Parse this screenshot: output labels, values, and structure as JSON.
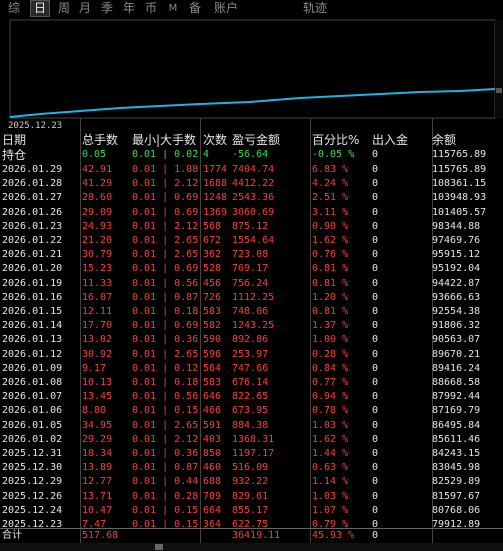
{
  "tabs": [
    "综",
    "日",
    "周",
    "月",
    "季",
    "年",
    "币",
    "M",
    "备",
    "账户",
    "轨迹"
  ],
  "active_tab": "日",
  "chart": {
    "start_date_label": "2025.12.23",
    "line_color": "#1fb2e6"
  },
  "headers": {
    "date": "日期",
    "lots": "总手数",
    "minmax": "最小|大手数",
    "count": "次数",
    "pnl": "盈亏金额",
    "pct": "百分比%",
    "flow": "出入金",
    "balance": "余额"
  },
  "position_row": {
    "date": "持仓",
    "lots": "0.05",
    "minmax": "0.01 | 0.02",
    "count": "4",
    "pnl": "-56.64",
    "pct": "-0.05 %",
    "flow": "0",
    "balance": "115765.89"
  },
  "rows": [
    {
      "date": "2026.01.29",
      "lots": "42.91",
      "minmax": "0.01 | 1.08",
      "count": "1774",
      "pnl": "7404.74",
      "pct": "6.83 %",
      "flow": "0",
      "balance": "115765.89"
    },
    {
      "date": "2026.01.28",
      "lots": "41.29",
      "minmax": "0.01 | 2.12",
      "count": "1688",
      "pnl": "4412.22",
      "pct": "4.24 %",
      "flow": "0",
      "balance": "108361.15"
    },
    {
      "date": "2026.01.27",
      "lots": "28.60",
      "minmax": "0.01 | 0.69",
      "count": "1248",
      "pnl": "2543.36",
      "pct": "2.51 %",
      "flow": "0",
      "balance": "103948.93"
    },
    {
      "date": "2026.01.26",
      "lots": "29.09",
      "minmax": "0.01 | 0.69",
      "count": "1369",
      "pnl": "3060.69",
      "pct": "3.11 %",
      "flow": "0",
      "balance": "101405.57"
    },
    {
      "date": "2026.01.23",
      "lots": "24.93",
      "minmax": "0.01 | 2.12",
      "count": "568",
      "pnl": "875.12",
      "pct": "0.90 %",
      "flow": "0",
      "balance": "98344.88"
    },
    {
      "date": "2026.01.22",
      "lots": "21.20",
      "minmax": "0.01 | 2.65",
      "count": "672",
      "pnl": "1554.64",
      "pct": "1.62 %",
      "flow": "0",
      "balance": "97469.76"
    },
    {
      "date": "2026.01.21",
      "lots": "30.79",
      "minmax": "0.01 | 2.65",
      "count": "362",
      "pnl": "723.08",
      "pct": "0.76 %",
      "flow": "0",
      "balance": "95915.12"
    },
    {
      "date": "2026.01.20",
      "lots": "15.23",
      "minmax": "0.01 | 0.69",
      "count": "528",
      "pnl": "769.17",
      "pct": "0.81 %",
      "flow": "0",
      "balance": "95192.04"
    },
    {
      "date": "2026.01.19",
      "lots": "11.33",
      "minmax": "0.01 | 0.56",
      "count": "456",
      "pnl": "756.24",
      "pct": "0.81 %",
      "flow": "0",
      "balance": "94422.87"
    },
    {
      "date": "2026.01.16",
      "lots": "16.07",
      "minmax": "0.01 | 0.87",
      "count": "726",
      "pnl": "1112.25",
      "pct": "1.20 %",
      "flow": "0",
      "balance": "93666.63"
    },
    {
      "date": "2026.01.15",
      "lots": "12.11",
      "minmax": "0.01 | 0.18",
      "count": "583",
      "pnl": "748.06",
      "pct": "0.81 %",
      "flow": "0",
      "balance": "92554.38"
    },
    {
      "date": "2026.01.14",
      "lots": "17.70",
      "minmax": "0.01 | 0.69",
      "count": "582",
      "pnl": "1243.25",
      "pct": "1.37 %",
      "flow": "0",
      "balance": "91806.32"
    },
    {
      "date": "2026.01.13",
      "lots": "13.02",
      "minmax": "0.01 | 0.36",
      "count": "590",
      "pnl": "892.86",
      "pct": "1.00 %",
      "flow": "0",
      "balance": "90563.07"
    },
    {
      "date": "2026.01.12",
      "lots": "30.92",
      "minmax": "0.01 | 2.65",
      "count": "596",
      "pnl": "253.97",
      "pct": "0.28 %",
      "flow": "0",
      "balance": "89670.21"
    },
    {
      "date": "2026.01.09",
      "lots": "9.17",
      "minmax": "0.01 | 0.12",
      "count": "564",
      "pnl": "747.66",
      "pct": "0.84 %",
      "flow": "0",
      "balance": "89416.24"
    },
    {
      "date": "2026.01.08",
      "lots": "10.13",
      "minmax": "0.01 | 0.18",
      "count": "583",
      "pnl": "676.14",
      "pct": "0.77 %",
      "flow": "0",
      "balance": "88668.58"
    },
    {
      "date": "2026.01.07",
      "lots": "13.45",
      "minmax": "0.01 | 0.56",
      "count": "646",
      "pnl": "822.65",
      "pct": "0.94 %",
      "flow": "0",
      "balance": "87992.44"
    },
    {
      "date": "2026.01.06",
      "lots": "8.80",
      "minmax": "0.01 | 0.15",
      "count": "466",
      "pnl": "673.95",
      "pct": "0.78 %",
      "flow": "0",
      "balance": "87169.79"
    },
    {
      "date": "2026.01.05",
      "lots": "34.95",
      "minmax": "0.01 | 2.65",
      "count": "591",
      "pnl": "884.38",
      "pct": "1.03 %",
      "flow": "0",
      "balance": "86495.84"
    },
    {
      "date": "2026.01.02",
      "lots": "29.29",
      "minmax": "0.01 | 2.12",
      "count": "403",
      "pnl": "1368.31",
      "pct": "1.62 %",
      "flow": "0",
      "balance": "85611.46"
    },
    {
      "date": "2025.12.31",
      "lots": "18.34",
      "minmax": "0.01 | 0.36",
      "count": "850",
      "pnl": "1197.17",
      "pct": "1.44 %",
      "flow": "0",
      "balance": "84243.15"
    },
    {
      "date": "2025.12.30",
      "lots": "13.89",
      "minmax": "0.01 | 0.87",
      "count": "460",
      "pnl": "516.09",
      "pct": "0.63 %",
      "flow": "0",
      "balance": "83045.98"
    },
    {
      "date": "2025.12.29",
      "lots": "12.77",
      "minmax": "0.01 | 0.44",
      "count": "688",
      "pnl": "932.22",
      "pct": "1.14 %",
      "flow": "0",
      "balance": "82529.89"
    },
    {
      "date": "2025.12.26",
      "lots": "13.71",
      "minmax": "0.01 | 0.28",
      "count": "709",
      "pnl": "829.61",
      "pct": "1.03 %",
      "flow": "0",
      "balance": "81597.67"
    },
    {
      "date": "2025.12.24",
      "lots": "10.47",
      "minmax": "0.01 | 0.15",
      "count": "664",
      "pnl": "855.17",
      "pct": "1.07 %",
      "flow": "0",
      "balance": "80768.06"
    },
    {
      "date": "2025.12.23",
      "lots": "7.47",
      "minmax": "0.01 | 0.15",
      "count": "364",
      "pnl": "622.75",
      "pct": "0.79 %",
      "flow": "0",
      "balance": "79912.89"
    }
  ],
  "total": {
    "label": "合计",
    "lots": "517.68",
    "pnl": "36419.11",
    "pct": "45.93 %",
    "flow": "0"
  }
}
